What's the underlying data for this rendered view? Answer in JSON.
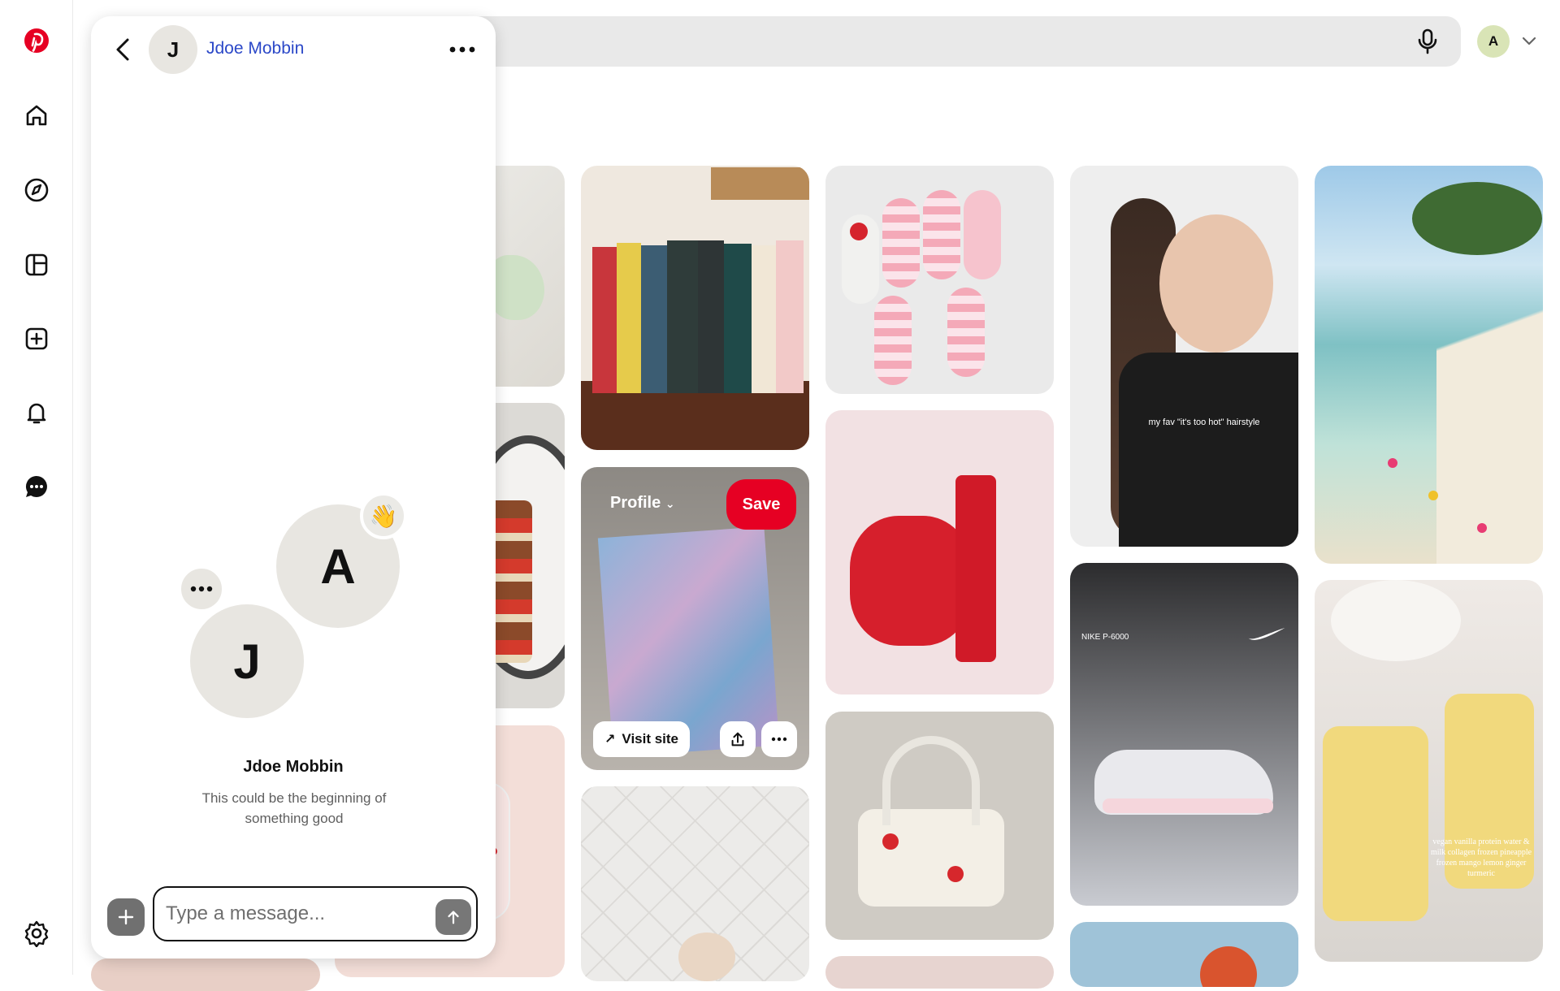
{
  "nav": {
    "items": [
      "home",
      "explore",
      "boards",
      "create",
      "notifications",
      "messages",
      "settings"
    ]
  },
  "header": {
    "avatar_letter": "A"
  },
  "chat": {
    "contact_initial": "J",
    "contact_name": "Jdoe Mobbin",
    "self_initial": "A",
    "wave_emoji": "👋",
    "intro_name": "Jdoe Mobbin",
    "intro_subtitle": "This could be the beginning of something good",
    "input_placeholder": "Type a message..."
  },
  "pin_overlay": {
    "board_label": "Profile",
    "save_label": "Save",
    "visit_label": "Visit site"
  },
  "pins": {
    "hairstyle_caption": "my fav \"it's too hot\" hairstyle",
    "shoe_caption": "NIKE P-6000",
    "recipe_caption": "vegan vanilla protein water & milk collagen frozen pineapple frozen mango lemon ginger turmeric"
  },
  "colors": {
    "brand_red": "#e60023",
    "link_blue": "#2b48c8"
  }
}
